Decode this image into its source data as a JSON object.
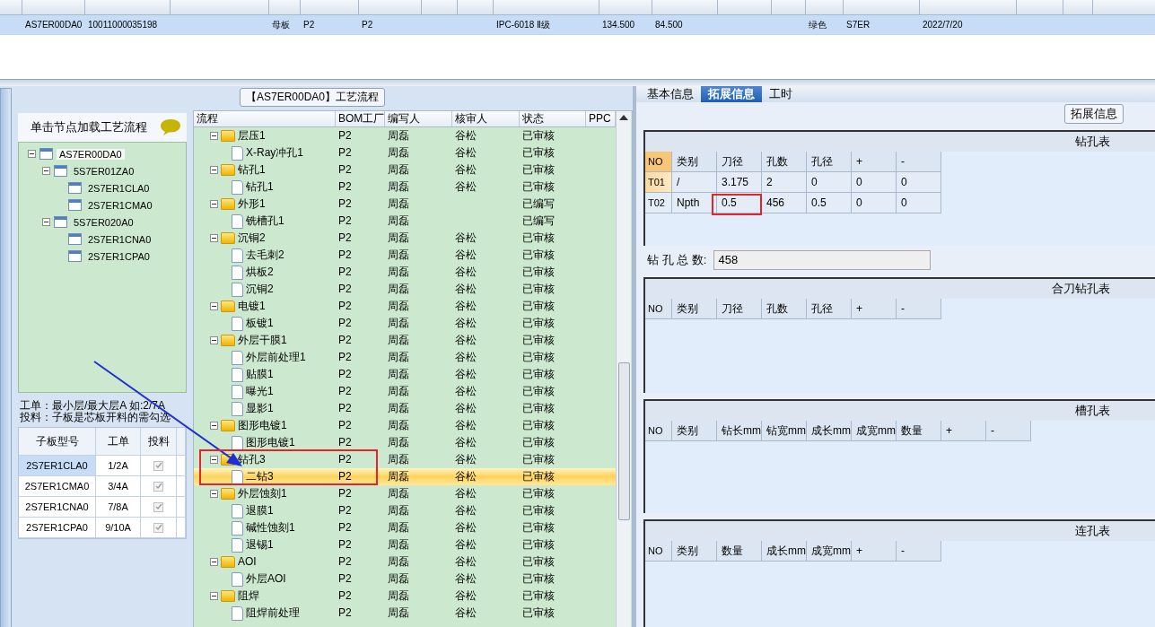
{
  "record_table": {
    "rows": [
      {
        "selected": true,
        "column_1": "AS7ER00DA0",
        "column_2": "10011000035198",
        "column_4": "母板",
        "column_5": "P2",
        "column_6": "P2",
        "column_9": "IPC-6018 Ⅱ级",
        "column_10": "134.500",
        "column_11": "84.500",
        "column_14": "绿色",
        "column_15": "S7ER",
        "column_16": "2022/7/20"
      }
    ]
  },
  "left": {
    "header": "单击节点加载工艺流程",
    "tree": [
      {
        "label": "AS7ER00DA0",
        "expanded": true,
        "selected": true,
        "children": [
          {
            "label": "5S7ER01ZA0",
            "expanded": true,
            "selected": false,
            "children": [
              {
                "label": "2S7ER1CLA0",
                "selected": false
              },
              {
                "label": "2S7ER1CMA0",
                "selected": false
              }
            ]
          },
          {
            "label": "5S7ER020A0",
            "expanded": true,
            "selected": false,
            "children": [
              {
                "label": "2S7ER1CNA0",
                "selected": false
              },
              {
                "label": "2S7ER1CPA0",
                "selected": false
              }
            ]
          }
        ]
      }
    ],
    "notes": [
      "工单：最小层/最大层A 如:2/7A",
      "投料：子板是芯板开料的需勾选"
    ],
    "sub_boards": {
      "columns": [
        "子板型号",
        "工单",
        "投料"
      ],
      "rows": [
        {
          "model": "2S7ER1CLA0",
          "order": "1/2A",
          "checked": true,
          "selected": true
        },
        {
          "model": "2S7ER1CMA0",
          "order": "3/4A",
          "checked": true,
          "selected": false
        },
        {
          "model": "2S7ER1CNA0",
          "order": "7/8A",
          "checked": true,
          "selected": false
        },
        {
          "model": "2S7ER1CPA0",
          "order": "9/10A",
          "checked": true,
          "selected": false
        }
      ]
    }
  },
  "process": {
    "title": "【AS7ER00DA0】工艺流程",
    "columns": [
      "流程",
      "BOM工厂",
      "编写人",
      "核审人",
      "状态",
      "PPC"
    ],
    "items": [
      {
        "name": "层压1",
        "factory": "P2",
        "writer": "周磊",
        "reviewer": "谷松",
        "status": "已审核",
        "expanded": true,
        "selected": false,
        "children": [
          {
            "name": "X-Ray冲孔1",
            "factory": "P2",
            "writer": "周磊",
            "reviewer": "谷松",
            "status": "已审核",
            "selected": false
          }
        ]
      },
      {
        "name": "钻孔1",
        "factory": "P2",
        "writer": "周磊",
        "reviewer": "谷松",
        "status": "已审核",
        "expanded": true,
        "selected": false,
        "children": [
          {
            "name": "钻孔1",
            "factory": "P2",
            "writer": "周磊",
            "reviewer": "谷松",
            "status": "已审核",
            "selected": false
          }
        ]
      },
      {
        "name": "外形1",
        "factory": "P2",
        "writer": "周磊",
        "status": "已编写",
        "expanded": true,
        "selected": false,
        "children": [
          {
            "name": "铣槽孔1",
            "factory": "P2",
            "writer": "周磊",
            "status": "已编写",
            "selected": false
          }
        ]
      },
      {
        "name": "沉铜2",
        "factory": "P2",
        "writer": "周磊",
        "reviewer": "谷松",
        "status": "已审核",
        "expanded": true,
        "selected": false,
        "children": [
          {
            "name": "去毛刺2",
            "factory": "P2",
            "writer": "周磊",
            "reviewer": "谷松",
            "status": "已审核",
            "selected": false
          },
          {
            "name": "烘板2",
            "factory": "P2",
            "writer": "周磊",
            "reviewer": "谷松",
            "status": "已审核",
            "selected": false
          },
          {
            "name": "沉铜2",
            "factory": "P2",
            "writer": "周磊",
            "reviewer": "谷松",
            "status": "已审核",
            "selected": false
          }
        ]
      },
      {
        "name": "电镀1",
        "factory": "P2",
        "writer": "周磊",
        "reviewer": "谷松",
        "status": "已审核",
        "expanded": true,
        "selected": false,
        "children": [
          {
            "name": "板镀1",
            "factory": "P2",
            "writer": "周磊",
            "reviewer": "谷松",
            "status": "已审核",
            "selected": false
          }
        ]
      },
      {
        "name": "外层干膜1",
        "factory": "P2",
        "writer": "周磊",
        "reviewer": "谷松",
        "status": "已审核",
        "expanded": true,
        "selected": false,
        "children": [
          {
            "name": "外层前处理1",
            "factory": "P2",
            "writer": "周磊",
            "reviewer": "谷松",
            "status": "已审核",
            "selected": false
          },
          {
            "name": "贴膜1",
            "factory": "P2",
            "writer": "周磊",
            "reviewer": "谷松",
            "status": "已审核",
            "selected": false
          },
          {
            "name": "曝光1",
            "factory": "P2",
            "writer": "周磊",
            "reviewer": "谷松",
            "status": "已审核",
            "selected": false
          },
          {
            "name": "显影1",
            "factory": "P2",
            "writer": "周磊",
            "reviewer": "谷松",
            "status": "已审核",
            "selected": false
          }
        ]
      },
      {
        "name": "图形电镀1",
        "factory": "P2",
        "writer": "周磊",
        "reviewer": "谷松",
        "status": "已审核",
        "expanded": true,
        "selected": false,
        "children": [
          {
            "name": "图形电镀1",
            "factory": "P2",
            "writer": "周磊",
            "reviewer": "谷松",
            "status": "已审核",
            "selected": false
          }
        ]
      },
      {
        "name": "钻孔3",
        "factory": "P2",
        "writer": "周磊",
        "reviewer": "谷松",
        "status": "已审核",
        "expanded": true,
        "selected": false,
        "children": [
          {
            "name": "二钻3",
            "factory": "P2",
            "writer": "周磊",
            "reviewer": "谷松",
            "status": "已审核",
            "selected": true
          }
        ]
      },
      {
        "name": "外层蚀刻1",
        "factory": "P2",
        "writer": "周磊",
        "reviewer": "谷松",
        "status": "已审核",
        "expanded": true,
        "selected": false,
        "children": [
          {
            "name": "退膜1",
            "factory": "P2",
            "writer": "周磊",
            "reviewer": "谷松",
            "status": "已审核",
            "selected": false
          },
          {
            "name": "碱性蚀刻1",
            "factory": "P2",
            "writer": "周磊",
            "reviewer": "谷松",
            "status": "已审核",
            "selected": false
          },
          {
            "name": "退锡1",
            "factory": "P2",
            "writer": "周磊",
            "reviewer": "谷松",
            "status": "已审核",
            "selected": false
          }
        ]
      },
      {
        "name": "AOI",
        "factory": "P2",
        "writer": "周磊",
        "reviewer": "谷松",
        "status": "已审核",
        "expanded": true,
        "selected": false,
        "children": [
          {
            "name": "外层AOI",
            "factory": "P2",
            "writer": "周磊",
            "reviewer": "谷松",
            "status": "已审核",
            "selected": false
          }
        ]
      },
      {
        "name": "阻焊",
        "factory": "P2",
        "writer": "周磊",
        "reviewer": "谷松",
        "status": "已审核",
        "expanded": true,
        "selected": false,
        "children": [
          {
            "name": "阻焊前处理",
            "factory": "P2",
            "writer": "周磊",
            "reviewer": "谷松",
            "status": "已审核",
            "selected": false
          }
        ]
      }
    ]
  },
  "right": {
    "tabs": [
      {
        "label": "基本信息",
        "selected": false
      },
      {
        "label": "拓展信息",
        "selected": true
      },
      {
        "label": "工时",
        "selected": false
      }
    ],
    "group_label": "拓展信息",
    "drill_table": {
      "title": "钻孔表",
      "columns": [
        "NO",
        "类别",
        "刀径",
        "孔数",
        "孔径",
        "+",
        "-"
      ],
      "rows": [
        {
          "selected": true,
          "cells": [
            "T01",
            "/",
            "3.175",
            "2",
            "0",
            "0",
            "0"
          ]
        },
        {
          "selected": false,
          "cells": [
            "T02",
            "Npth",
            "0.5",
            "456",
            "0.5",
            "0",
            "0"
          ]
        }
      ]
    },
    "drill_total": {
      "label": "钻 孔 总 数:",
      "value": "458"
    },
    "merged_table": {
      "title": "合刀钻孔表",
      "columns": [
        "NO",
        "类别",
        "刀径",
        "孔数",
        "孔径",
        "+",
        "-"
      ]
    },
    "slot_table": {
      "title": "槽孔表",
      "columns": [
        "NO",
        "类别",
        "钻长mm",
        "钻宽mm",
        "成长mm",
        "成宽mm",
        "数量",
        "+",
        "-"
      ]
    },
    "link_table": {
      "title": "连孔表",
      "columns": [
        "NO",
        "类别",
        "数量",
        "成长mm",
        "成宽mm",
        "+",
        "-"
      ]
    }
  }
}
